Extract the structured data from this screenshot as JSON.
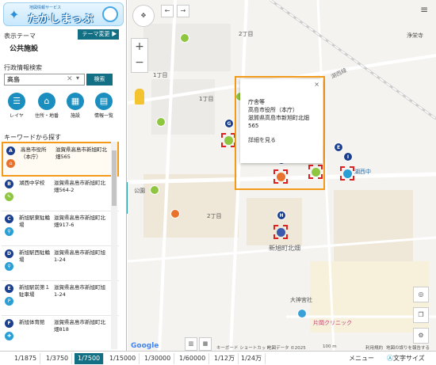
{
  "header": {
    "logo_subtitle": "地図情報サービス",
    "logo_title": "たかしまっぷ"
  },
  "theme": {
    "label": "表示テーマ",
    "change_button": "テーマ変更 ▶",
    "current": "公共施設"
  },
  "search": {
    "label": "行政情報検索",
    "value": "高島",
    "button": "検索"
  },
  "tools": [
    {
      "label": "レイヤ",
      "icon": "list-icon"
    },
    {
      "label": "住所・地番",
      "icon": "home-icon"
    },
    {
      "label": "施設",
      "icon": "building-icon"
    },
    {
      "label": "情報一覧",
      "icon": "table-icon"
    }
  ],
  "keyword": {
    "title": "キーワードから探す"
  },
  "results": [
    {
      "pin": "A",
      "name": "高島市役所（本庁）",
      "address": "滋賀県高島市新旭町北畑565",
      "color": "#e8722d"
    },
    {
      "pin": "B",
      "name": "湖西中学校",
      "address": "滋賀県高島市新旭町北畑564-2",
      "color": "#8ec63f"
    },
    {
      "pin": "C",
      "name": "新旭駅東駐輪場",
      "address": "滋賀県高島市新旭町北畑917-6",
      "color": "#2a9fd6"
    },
    {
      "pin": "D",
      "name": "新旭駅西駐輪場",
      "address": "滋賀県高島市新旭町旭1-24",
      "color": "#2a9fd6"
    },
    {
      "pin": "E",
      "name": "新旭駅前第１駐車場",
      "address": "滋賀県高島市新旭町旭1-24",
      "color": "#2a9fd6"
    },
    {
      "pin": "F",
      "name": "新旭体育館",
      "address": "滋賀県高島市新旭町北畑818",
      "color": "#2a9fd6"
    }
  ],
  "map_labels": {
    "chome1": "1丁目",
    "chome2": "2丁目",
    "kohoku": "新旭町北畑",
    "shrine": "大神宮社",
    "clinic": "片岡クリニック",
    "park": "公園",
    "area": "浄栄寺",
    "rail": "湖西線",
    "google": "Google",
    "shortcut": "キーボード ショートカット",
    "mapdata": "地図データ ©2025",
    "scale": "100 m",
    "terms": "利用規約",
    "report": "地図の誤りを報告する",
    "junior": "湖西中"
  },
  "popup": {
    "category": "庁舎等",
    "name": "高島市役所（本庁）",
    "address": "滋賀県高島市新旭町北畑565",
    "link": "詳細を見る",
    "close": "×"
  },
  "markers": [
    {
      "label": "A"
    },
    {
      "label": "G"
    },
    {
      "label": "H"
    },
    {
      "label": "I"
    },
    {
      "label": "E"
    }
  ],
  "bottom": {
    "scales": [
      "1/1875",
      "1/3750",
      "1/7500",
      "1/15000",
      "1/30000",
      "1/60000",
      "1/12万",
      "1/24万"
    ],
    "active_scale": "1/7500",
    "menu": "メニュー",
    "font_size": "文字サイズ"
  }
}
